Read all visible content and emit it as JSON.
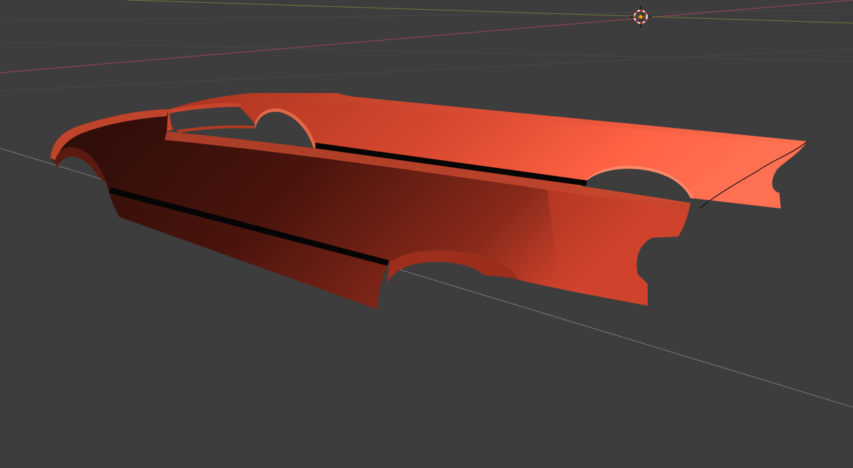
{
  "viewport": {
    "background_color": "#3d3d3d",
    "grid_line_color": "#4a4a4a",
    "x_axis_color": "#b0444f",
    "y_axis_color": "#7d8a3a",
    "reference_line_color": "#8a8a8a"
  },
  "model": {
    "object": "car-body-side-panels",
    "material_color": "#e8533c",
    "highlight_color": "#ff6a4d",
    "shadow_color": "#3a100b",
    "stripe_color": "#050505"
  },
  "cursor_3d": {
    "icon": "3d-cursor-icon",
    "ring_colors": [
      "#e03030",
      "#ffffff"
    ],
    "center_color": "#ff9a00"
  }
}
